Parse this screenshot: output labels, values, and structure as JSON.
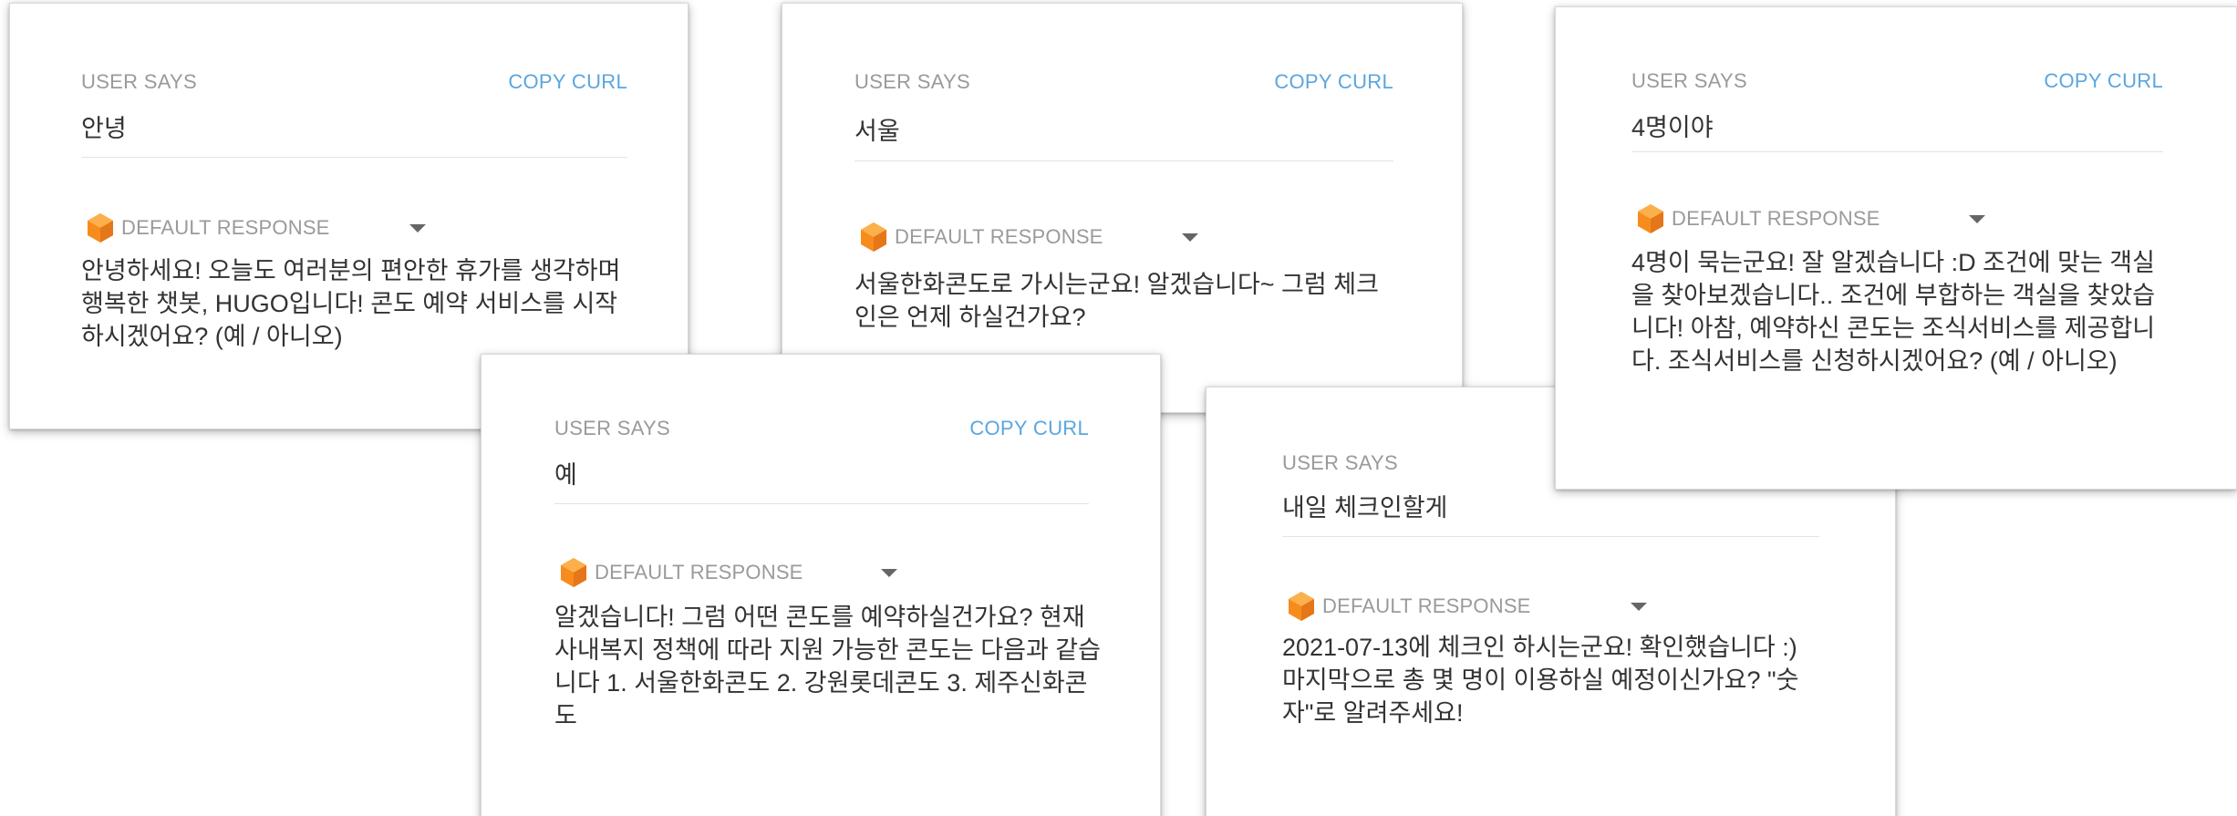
{
  "common": {
    "user_says_label": "USER SAYS",
    "copy_curl_label": "COPY CURL",
    "default_response_label": "DEFAULT RESPONSE",
    "cube_icon": "dialogflow-cube-icon",
    "cube_color": "#f78c1c",
    "accent_color": "#5aa6e0"
  },
  "cards": [
    {
      "user_text": "안녕",
      "response_text": "안녕하세요! 오늘도 여러분의 편안한 휴가를 생각하며 행복한 챗봇, HUGO입니다! 콘도 예약 서비스를 시작하시겠어요? (예 / 아니오)"
    },
    {
      "user_text": "서울",
      "response_text": "서울한화콘도로 가시는군요! 알겠습니다~ 그럼 체크인은 언제 하실건가요?"
    },
    {
      "user_text": "4명이야",
      "response_text": "4명이 묵는군요! 잘 알겠습니다 :D 조건에 맞는 객실을 찾아보겠습니다.. 조건에 부합하는 객실을 찾았습니다! 아참, 예약하신 콘도는 조식서비스를 제공합니다. 조식서비스를 신청하시겠어요? (예 / 아니오)"
    },
    {
      "user_text": "예",
      "response_text": "알겠습니다! 그럼 어떤 콘도를 예약하실건가요? 현재 사내복지 정책에 따라 지원 가능한 콘도는 다음과 같습니다 1. 서울한화콘도 2. 강원롯데콘도 3. 제주신화콘도"
    },
    {
      "user_text": "내일 체크인할게",
      "response_text": "2021-07-13에 체크인 하시는군요! 확인했습니다 :) 마지막으로 총 몇 명이 이용하실 예정이신가요? \"숫자\"로 알려주세요!"
    }
  ]
}
